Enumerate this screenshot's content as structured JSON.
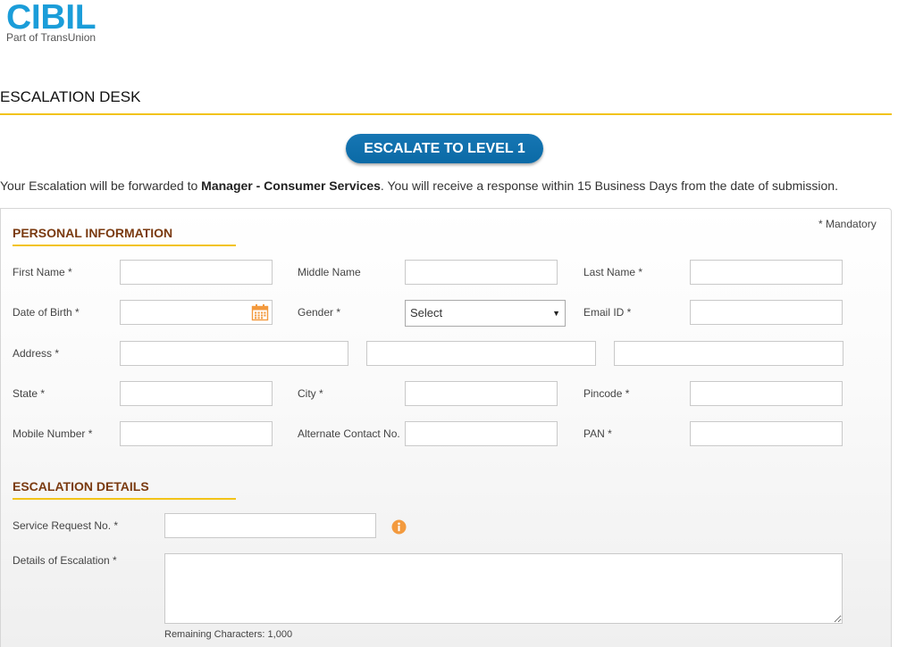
{
  "brand": {
    "name": "CIBIL",
    "tagline": "Part of TransUnion"
  },
  "colors": {
    "brand_blue": "#1b9dd9",
    "button_blue": "#0b6aa6",
    "accent_yellow": "#f2c318",
    "section_heading": "#7a3a10",
    "icon_orange": "#f39a3e"
  },
  "page_title": "ESCALATION DESK",
  "escalate_button": {
    "label": "ESCALATE TO LEVEL 1"
  },
  "notice": {
    "before": "Your Escalation will be forwarded to ",
    "emphasis": "Manager - Consumer Services",
    "after": ". You will receive a response within 15 Business Days from the date of submission."
  },
  "form": {
    "mandatory_note": "* Mandatory",
    "personal_information": {
      "title": "PERSONAL INFORMATION",
      "first_name": {
        "label": "First Name *",
        "value": ""
      },
      "middle_name": {
        "label": "Middle Name",
        "value": ""
      },
      "last_name": {
        "label": "Last Name *",
        "value": ""
      },
      "date_of_birth": {
        "label": "Date of Birth *",
        "value": "",
        "icon": "calendar-icon"
      },
      "gender": {
        "label": "Gender *",
        "selected": "Select",
        "icon": "chevron-down-icon"
      },
      "email_id": {
        "label": "Email ID *",
        "value": ""
      },
      "address": {
        "label": "Address *",
        "lines": [
          "",
          "",
          ""
        ]
      },
      "state": {
        "label": "State *",
        "value": ""
      },
      "city": {
        "label": "City *",
        "value": ""
      },
      "pincode": {
        "label": "Pincode *",
        "value": ""
      },
      "mobile_number": {
        "label": "Mobile Number *",
        "value": ""
      },
      "alternate_contact": {
        "label": "Alternate Contact No.",
        "value": ""
      },
      "pan": {
        "label": "PAN *",
        "value": ""
      }
    },
    "escalation_details": {
      "title": "ESCALATION DETAILS",
      "service_request_no": {
        "label": "Service Request No. *",
        "value": "",
        "icon": "info-icon"
      },
      "details": {
        "label": "Details of Escalation *",
        "value": "",
        "remaining_characters": "Remaining Characters: 1,000"
      }
    }
  }
}
